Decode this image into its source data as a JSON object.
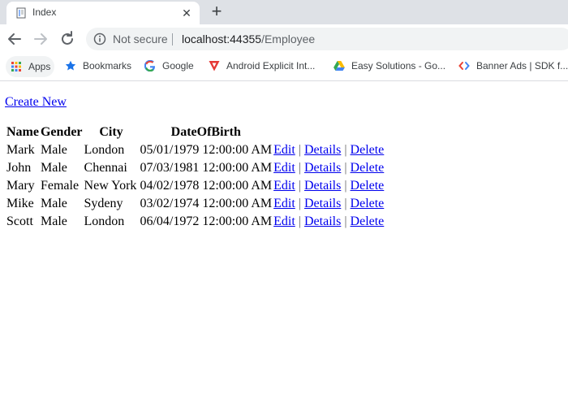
{
  "browser": {
    "tab": {
      "title": "Index",
      "close_glyph": "✕"
    },
    "new_tab_glyph": "+",
    "address": {
      "security_label": "Not secure",
      "url_host": "localhost:44355",
      "url_path": "/Employee"
    },
    "bookmarks": [
      {
        "label": "Apps",
        "icon": "apps-grid-icon"
      },
      {
        "label": "Bookmarks",
        "icon": "star-icon"
      },
      {
        "label": "Google",
        "icon": "google-g-icon"
      },
      {
        "label": "Android Explicit Int...",
        "icon": "android-v-icon"
      },
      {
        "label": "Easy Solutions - Go...",
        "icon": "google-drive-icon"
      },
      {
        "label": "Banner Ads  |  SDK f...",
        "icon": "admob-icon"
      }
    ]
  },
  "page": {
    "create_new_label": "Create New",
    "columns": [
      "Name",
      "Gender",
      "City",
      "DateOfBirth"
    ],
    "rows": [
      {
        "name": "Mark",
        "gender": "Male",
        "city": "London",
        "dob": "05/01/1979 12:00:00 AM"
      },
      {
        "name": "John",
        "gender": "Male",
        "city": "Chennai",
        "dob": "07/03/1981 12:00:00 AM"
      },
      {
        "name": "Mary",
        "gender": "Female",
        "city": "New York",
        "dob": "04/02/1978 12:00:00 AM"
      },
      {
        "name": "Mike",
        "gender": "Male",
        "city": "Sydeny",
        "dob": "03/02/1974 12:00:00 AM"
      },
      {
        "name": "Scott",
        "gender": "Male",
        "city": "London",
        "dob": "06/04/1972 12:00:00 AM"
      }
    ],
    "row_actions": {
      "edit": "Edit",
      "details": "Details",
      "delete": "Delete",
      "separator": "|"
    }
  }
}
